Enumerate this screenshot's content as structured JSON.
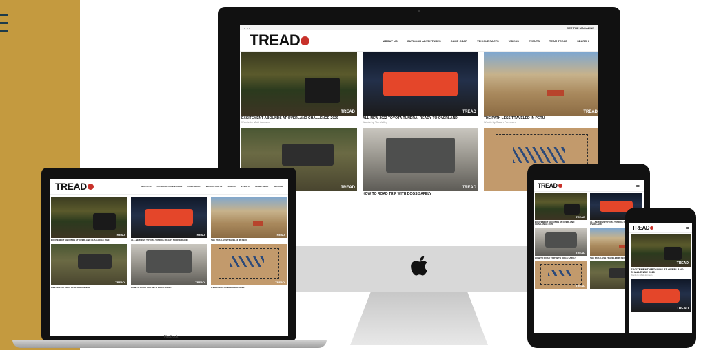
{
  "brand": {
    "logo": "TREAD",
    "accent": "#c8312a",
    "sidebar_color": "#c49a3f",
    "hamburger_color": "#1d3b4a"
  },
  "imac": {
    "topbar_right": "GET THE MAGAZINE",
    "menu": [
      "ABOUT US",
      "OUTDOOR ADVENTURES",
      "CAMP GEAR",
      "VEHICLE PARTS",
      "VIDEOS",
      "EVENTS",
      "TEAM TREAD",
      "SEARCH"
    ],
    "articles": [
      {
        "title": "EXCITEMENT ABOUNDS AT OVERLAND CHALLENGE 2020",
        "byline": "Words by Matt Johnson",
        "image": "forest"
      },
      {
        "title": "ALL-NEW 2022 TOYOTA TUNDRA: READY TO OVERLAND",
        "byline": "Words by Tim Valley",
        "image": "truck"
      },
      {
        "title": "THE PATH LESS TRAVELED IN PERU",
        "byline": "Words by Sarah Freeman",
        "image": "desert"
      },
      {
        "title": "",
        "byline": "",
        "image": "rocks"
      },
      {
        "title": "HOW TO ROAD TRIP WITH DOGS SAFELY",
        "byline": "",
        "image": "gear"
      },
      {
        "title": "",
        "byline": "",
        "image": "map"
      }
    ]
  },
  "macbook": {
    "label": "MacBook",
    "menu": [
      "ABOUT US",
      "OUTDOOR ADVENTURES",
      "CAMP GEAR",
      "VEHICLE PARTS",
      "VIDEOS",
      "EVENTS",
      "TEAM TREAD",
      "SEARCH"
    ],
    "articles": [
      {
        "title": "EXCITEMENT ABOUNDS AT OVERLAND CHALLENGE 2020",
        "image": "forest"
      },
      {
        "title": "ALL-NEW 2022 TOYOTA TUNDRA: READY TO OVERLAND",
        "image": "truck"
      },
      {
        "title": "THE PATH LESS TRAVELED IN PERU",
        "image": "desert"
      },
      {
        "title": "FIVE ADVENTURES OF OVERLANDING",
        "image": "rocks"
      },
      {
        "title": "HOW TO ROAD TRIP WITH DOGS SAFELY",
        "image": "gear"
      },
      {
        "title": "OVERLAND: LONG EXPEDITIONS",
        "image": "map"
      }
    ]
  },
  "ipad": {
    "articles": [
      {
        "title": "EXCITEMENT ABOUNDS AT OVERLAND CHALLENGE 2020",
        "image": "forest"
      },
      {
        "title": "ALL-NEW 2022 TOYOTA TUNDRA: READY TO OVERLAND",
        "image": "truck"
      },
      {
        "title": "HOW TO ROAD TRIP WITH DOGS SAFELY",
        "image": "gear"
      },
      {
        "title": "THE PATH LESS TRAVELED IN PERU",
        "image": "desert"
      },
      {
        "title": "",
        "image": "map"
      },
      {
        "title": "",
        "image": "rocks"
      }
    ]
  },
  "iphone": {
    "articles": [
      {
        "title": "EXCITEMENT ABOUNDS AT OVERLAND CHALLENGE 2020",
        "byline": "Words by Matt Johnson",
        "image": "forest"
      },
      {
        "title": "",
        "byline": "",
        "image": "truck"
      }
    ]
  }
}
